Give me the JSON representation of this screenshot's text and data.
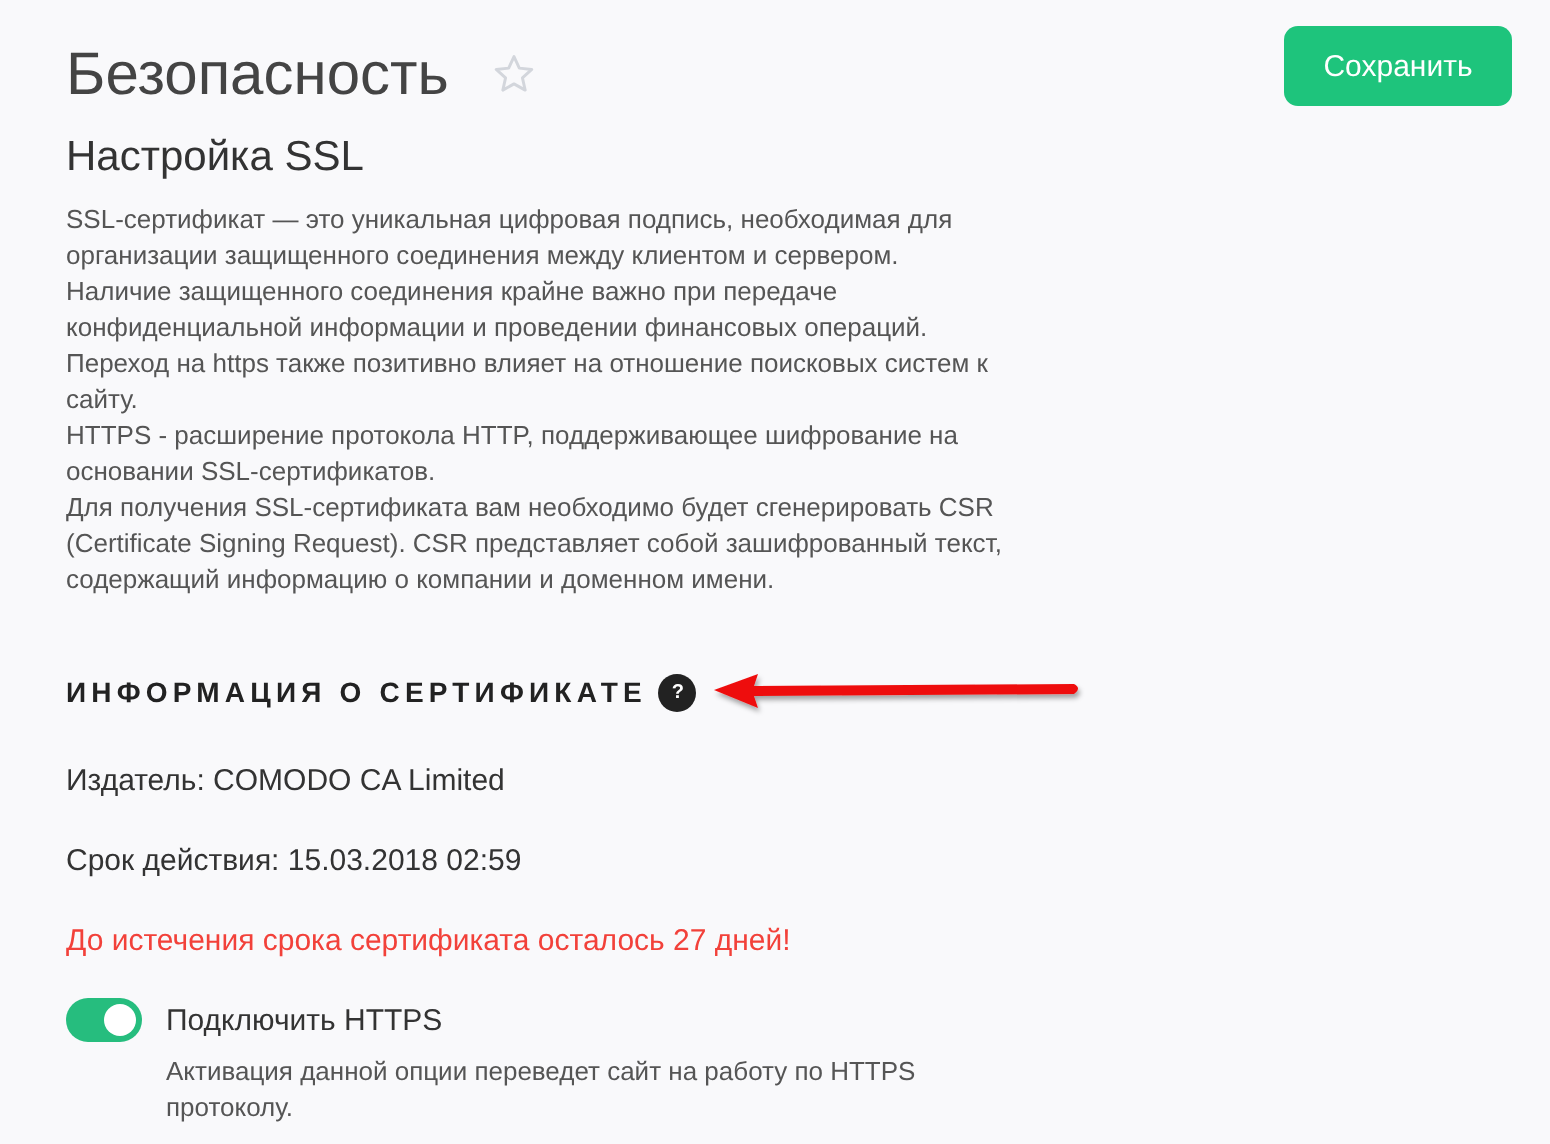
{
  "page": {
    "title": "Безопасность",
    "favorite": false,
    "save_button": "Сохранить"
  },
  "section": {
    "title": "Настройка SSL",
    "paragraphs": [
      "SSL-сертификат — это уникальная цифровая подпись, необходимая для организации защищенного соединения между клиентом и сервером.",
      "Наличие защищенного соединения крайне важно при передаче конфиденциальной информации и проведении финансовых операций.",
      "Переход на https также позитивно влияет на отношение поисковых систем к сайту.",
      "HTTPS - расширение протокола HTTP, поддерживающее шифрование на основании SSL-сертификатов.",
      "Для получения SSL-сертификата вам необходимо будет сгенерировать CSR (Certificate Signing Request). CSR представляет собой зашифрованный текст, содержащий информацию о компании и доменном имени."
    ]
  },
  "certificate": {
    "heading": "ИНФОРМАЦИЯ О СЕРТИФИКАТЕ",
    "help_icon": "?",
    "rows": [
      {
        "kind": "info",
        "text": "Издатель: COMODO CA Limited"
      },
      {
        "kind": "info",
        "text": "Срок действия: 15.03.2018 02:59"
      },
      {
        "kind": "warning",
        "text": "До истечения срока сертификата осталось 27 дней!"
      }
    ]
  },
  "https_toggle": {
    "label": "Подключить HTTPS",
    "on": true,
    "description": "Активация данной опции переведет сайт на работу по HTTPS протоколу."
  }
}
